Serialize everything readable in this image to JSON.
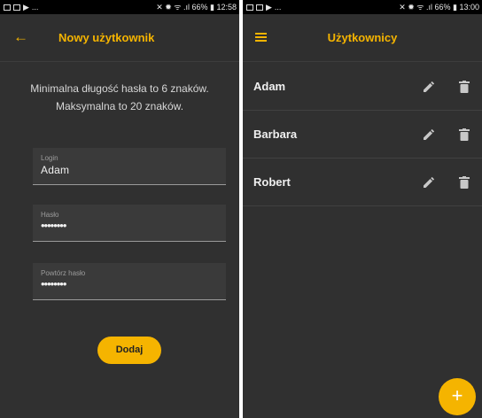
{
  "left_screen": {
    "status_bar": {
      "right_text": "✕ ✹ ᯤ .ıl 66% ▮ 12:58",
      "left_text": "..."
    },
    "app_bar": {
      "title": "Nowy użytkownik",
      "back_icon": "arrow-back-icon"
    },
    "info_lines": [
      "Minimalna długość hasła to 6 znaków.",
      "Maksymalna to 20 znaków."
    ],
    "fields": {
      "login": {
        "label": "Login",
        "value": "Adam"
      },
      "password": {
        "label": "Hasło",
        "value": "••••••••"
      },
      "repeat_password": {
        "label": "Powtórz hasło",
        "value": "••••••••"
      }
    },
    "add_button": "Dodaj"
  },
  "right_screen": {
    "status_bar": {
      "right_text": "✕ ✹ ᯤ .ıl 66% ▮ 13:00",
      "left_text": "..."
    },
    "app_bar": {
      "title": "Użytkownicy",
      "menu_icon": "hamburger-menu-icon"
    },
    "users": [
      {
        "name": "Adam"
      },
      {
        "name": "Barbara"
      },
      {
        "name": "Robert"
      }
    ],
    "row_icons": [
      "edit-pencil-icon",
      "delete-trash-icon"
    ],
    "fab_label": "+"
  },
  "colors": {
    "accent": "#f5b400",
    "background": "#303030",
    "field": "#3a3a3a",
    "status_bar": "#000000"
  }
}
